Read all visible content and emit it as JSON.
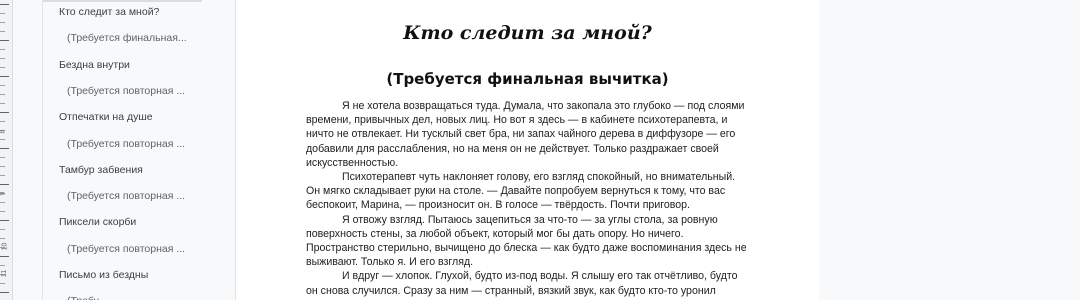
{
  "ruler": {
    "numbers": [
      "8",
      "9",
      "10",
      "11"
    ]
  },
  "outline": {
    "items": [
      {
        "label": "Кто следит за мной?",
        "level": 1
      },
      {
        "label": "(Требуется финальная...",
        "level": 2
      },
      {
        "label": "Бездна внутри",
        "level": 1
      },
      {
        "label": "(Требуется повторная ...",
        "level": 2
      },
      {
        "label": "Отпечатки на душе",
        "level": 1
      },
      {
        "label": "(Требуется повторная ...",
        "level": 2
      },
      {
        "label": "Тамбур забвения",
        "level": 1
      },
      {
        "label": "(Требуется повторная ...",
        "level": 2
      },
      {
        "label": "Пиксели скорби",
        "level": 1
      },
      {
        "label": "(Требуется повторная ...",
        "level": 2
      },
      {
        "label": "Письмо из бездны",
        "level": 1
      },
      {
        "label": "(Требу",
        "level": 2
      }
    ]
  },
  "document": {
    "title": "Кто следит за мной?",
    "subtitle": "(Требуется финальная вычитка)",
    "paragraphs": [
      "Я не хотела возвращаться туда. Думала, что закопала это глубоко — под слоями времени, привычных дел, новых лиц. Но вот я здесь — в кабинете психотерапевта, и ничто не отвлекает. Ни тусклый свет бра, ни запах чайного дерева в диффузоре — его добавили для расслабления, но на меня он не действует. Только раздражает своей искусственностью.",
      "Психотерапевт чуть наклоняет голову, его взгляд спокойный, но внимательный. Он мягко складывает руки на столе. — Давайте попробуем вернуться к тому, что вас беспокоит, Марина, — произносит он. В голосе — твёрдость. Почти приговор.",
      "Я отвожу взгляд. Пытаюсь зацепиться за что-то — за углы стола, за ровную поверхность стены, за любой объект, который мог бы дать опору. Но ничего. Пространство стерильно, вычищено до блеска — как будто даже воспоминания здесь не выживают. Только я. И его взгляд.",
      "И вдруг — хлопок. Глухой, будто из-под воды. Я слышу его так отчётливо, будто он снова случился. Сразу за ним — странный, вязкий звук, как будто кто-то уронил"
    ]
  }
}
